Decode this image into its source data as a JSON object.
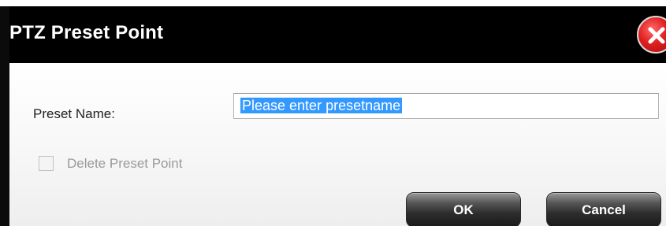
{
  "dialog": {
    "title": "PTZ Preset Point",
    "close_icon": "close-icon"
  },
  "form": {
    "preset_name_label": "Preset Name:",
    "preset_name_value": "Please enter presetname",
    "delete_label": "Delete Preset Point",
    "delete_checked": false
  },
  "buttons": {
    "ok_label": "OK",
    "cancel_label": "Cancel"
  },
  "colors": {
    "title_bar": "#000000",
    "selection": "#3399ff",
    "close_red": "#e02020"
  }
}
